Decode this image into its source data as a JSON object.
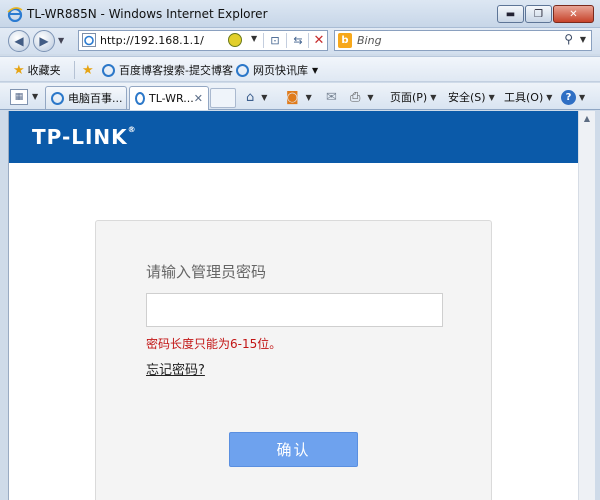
{
  "window": {
    "title": "TL-WR885N - Windows Internet Explorer",
    "minimize": "▬",
    "maximize": "❐",
    "close": "✕"
  },
  "address_bar": {
    "url": "http://192.168.1.1/"
  },
  "search": {
    "engine_logo": "b",
    "placeholder": "Bing"
  },
  "favorites_bar": {
    "favorites_label": "收藏夹",
    "items": [
      {
        "label": "百度博客搜索-提交博客"
      },
      {
        "label": "网页快讯库"
      }
    ]
  },
  "tabs": [
    {
      "label": "电脑百事...",
      "active": false
    },
    {
      "label": "TL-WR...",
      "active": true
    }
  ],
  "command_bar": {
    "page_label": "页面(P)",
    "safety_label": "安全(S)",
    "tools_label": "工具(O)",
    "help_glyph": "?"
  },
  "page": {
    "logo": "TP-LINK",
    "logo_mark": "®",
    "prompt": "请输入管理员密码",
    "password_value": "",
    "error": "密码长度只能为6-15位。",
    "forgot_link": "忘记密码?",
    "confirm_button": "确认"
  },
  "colors": {
    "header_blue": "#0b5aa9",
    "button_blue": "#6ea2ee",
    "error_red": "#c21515"
  },
  "icons": [
    "ie-logo-icon",
    "back-arrow-icon",
    "forward-arrow-icon",
    "compat-view-icon",
    "refresh-icon",
    "stop-icon",
    "search-icon",
    "favorites-star-icon",
    "add-favorite-icon",
    "home-icon",
    "rss-icon",
    "mail-icon",
    "print-icon",
    "help-icon"
  ]
}
